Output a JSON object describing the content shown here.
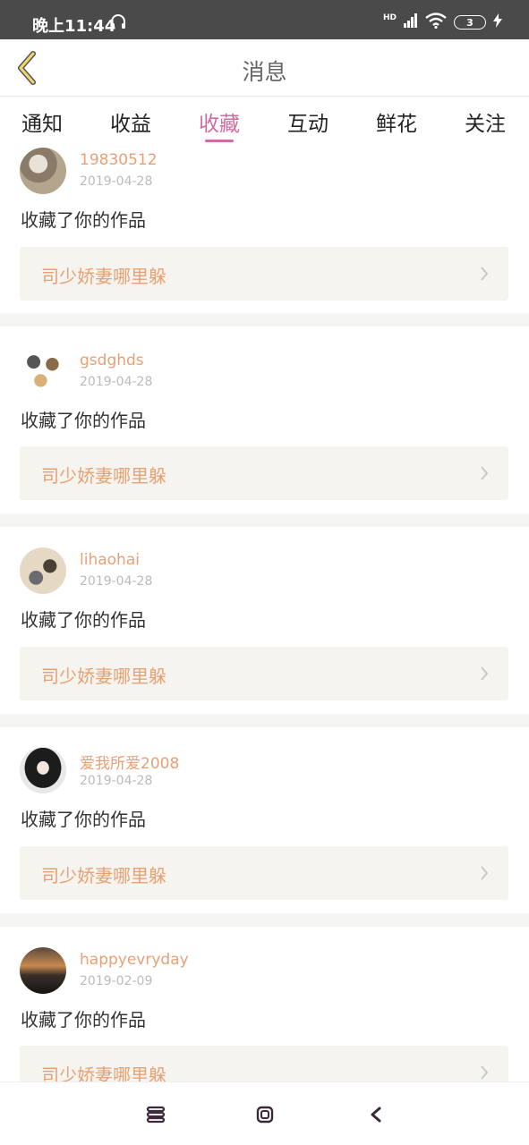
{
  "status_bar": {
    "time": "晚上11:44",
    "network": "HD",
    "battery": "3"
  },
  "header": {
    "title": "消息"
  },
  "tabs": [
    {
      "label": "通知",
      "active": false
    },
    {
      "label": "收益",
      "active": false
    },
    {
      "label": "收藏",
      "active": true
    },
    {
      "label": "互动",
      "active": false
    },
    {
      "label": "鲜花",
      "active": false
    },
    {
      "label": "关注",
      "active": false
    }
  ],
  "feed": [
    {
      "username": "19830512",
      "date": "2019-04-28",
      "action": "收藏了你的作品",
      "work_title": "司少娇妻哪里躲"
    },
    {
      "username": "gsdghds",
      "date": "2019-04-28",
      "action": "收藏了你的作品",
      "work_title": "司少娇妻哪里躲"
    },
    {
      "username": "lihaohai",
      "date": "2019-04-28",
      "action": "收藏了你的作品",
      "work_title": "司少娇妻哪里躲"
    },
    {
      "username": "爱我所爱2008",
      "date": "2019-04-28",
      "action": "收藏了你的作品",
      "work_title": "司少娇妻哪里躲"
    },
    {
      "username": "happyevryday",
      "date": "2019-02-09",
      "action": "收藏了你的作品",
      "work_title": "司少娇妻哪里躲"
    }
  ],
  "colors": {
    "accent": "#d36aa0",
    "username": "#e8a074",
    "card_bg": "#f5f4ee",
    "status_bar": "#4a4a4a"
  }
}
